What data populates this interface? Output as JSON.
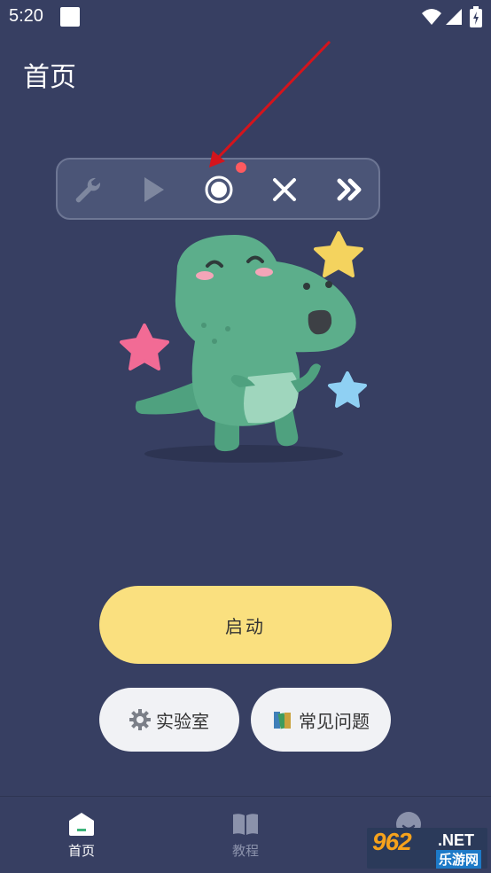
{
  "status_bar": {
    "time": "5:20",
    "icons": [
      "notification-square-icon",
      "wifi-icon",
      "signal-icon",
      "battery-charging-icon"
    ]
  },
  "page": {
    "title": "首页"
  },
  "floating_toolbar": {
    "buttons": [
      "wrench-icon",
      "play-icon",
      "record-icon",
      "close-icon",
      "fast-forward-icon"
    ],
    "record_indicator_color": "#ff5a5f"
  },
  "illustration": {
    "subject": "green-dinosaur-with-stars"
  },
  "actions": {
    "start_label": "启动",
    "lab_label": "实验室",
    "faq_label": "常见问题"
  },
  "bottom_nav": {
    "items": [
      {
        "label": "首页",
        "icon": "home-icon",
        "active": true
      },
      {
        "label": "教程",
        "icon": "book-icon",
        "active": false
      },
      {
        "label": "",
        "icon": "profile-icon",
        "active": false
      }
    ]
  },
  "watermark": {
    "number": "962",
    "suffix": ".NET",
    "site_name": "乐游网"
  },
  "colors": {
    "background": "#373f62",
    "start_button": "#fae07f",
    "pill_button": "#f1f2f5",
    "arrow": "#d4141c"
  }
}
